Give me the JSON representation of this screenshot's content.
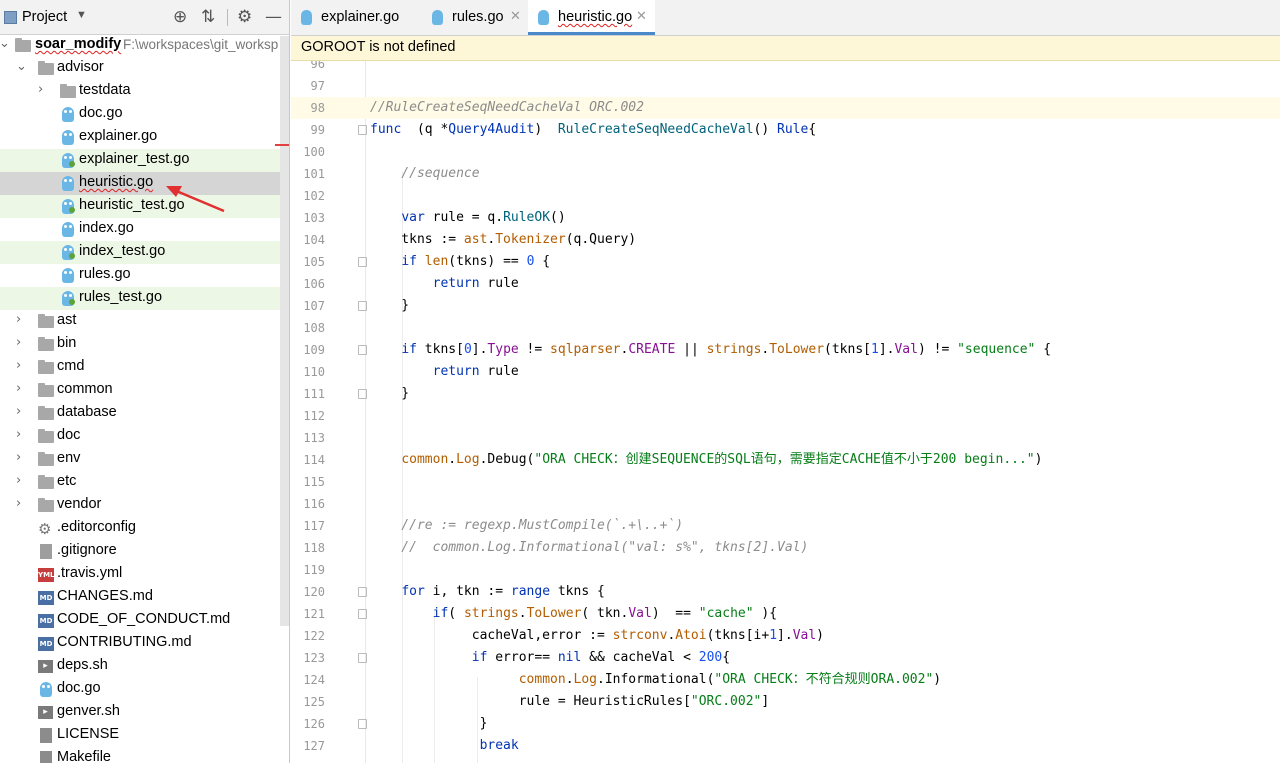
{
  "project": {
    "title": "Project",
    "root_name": "soar_modify",
    "root_path": "F:\\workspaces\\git_worksp",
    "tree": [
      {
        "label": "soar_modify",
        "depth": 0,
        "type": "root"
      },
      {
        "label": "advisor",
        "depth": 1,
        "type": "folder",
        "expanded": true
      },
      {
        "label": "testdata",
        "depth": 2,
        "type": "folder"
      },
      {
        "label": "doc.go",
        "depth": 2,
        "type": "go"
      },
      {
        "label": "explainer.go",
        "depth": 2,
        "type": "go"
      },
      {
        "label": "explainer_test.go",
        "depth": 2,
        "type": "go-test"
      },
      {
        "label": "heuristic.go",
        "depth": 2,
        "type": "go",
        "selected": true
      },
      {
        "label": "heuristic_test.go",
        "depth": 2,
        "type": "go-test"
      },
      {
        "label": "index.go",
        "depth": 2,
        "type": "go"
      },
      {
        "label": "index_test.go",
        "depth": 2,
        "type": "go-test"
      },
      {
        "label": "rules.go",
        "depth": 2,
        "type": "go"
      },
      {
        "label": "rules_test.go",
        "depth": 2,
        "type": "go-test"
      },
      {
        "label": "ast",
        "depth": 1,
        "type": "folder"
      },
      {
        "label": "bin",
        "depth": 1,
        "type": "folder"
      },
      {
        "label": "cmd",
        "depth": 1,
        "type": "folder"
      },
      {
        "label": "common",
        "depth": 1,
        "type": "folder"
      },
      {
        "label": "database",
        "depth": 1,
        "type": "folder"
      },
      {
        "label": "doc",
        "depth": 1,
        "type": "folder"
      },
      {
        "label": "env",
        "depth": 1,
        "type": "folder"
      },
      {
        "label": "etc",
        "depth": 1,
        "type": "folder"
      },
      {
        "label": "vendor",
        "depth": 1,
        "type": "folder"
      },
      {
        "label": ".editorconfig",
        "depth": 1,
        "type": "config"
      },
      {
        "label": ".gitignore",
        "depth": 1,
        "type": "gitignore"
      },
      {
        "label": ".travis.yml",
        "depth": 1,
        "type": "yml"
      },
      {
        "label": "CHANGES.md",
        "depth": 1,
        "type": "md"
      },
      {
        "label": "CODE_OF_CONDUCT.md",
        "depth": 1,
        "type": "md"
      },
      {
        "label": "CONTRIBUTING.md",
        "depth": 1,
        "type": "md"
      },
      {
        "label": "deps.sh",
        "depth": 1,
        "type": "sh"
      },
      {
        "label": "doc.go",
        "depth": 1,
        "type": "go"
      },
      {
        "label": "genver.sh",
        "depth": 1,
        "type": "sh"
      },
      {
        "label": "LICENSE",
        "depth": 1,
        "type": "license"
      },
      {
        "label": "Makefile",
        "depth": 1,
        "type": "license"
      }
    ]
  },
  "tabs": [
    {
      "label": "explainer.go",
      "active": false
    },
    {
      "label": "rules.go",
      "active": false
    },
    {
      "label": "heuristic.go",
      "active": true
    }
  ],
  "banner": "GOROOT is not defined",
  "code": {
    "lines": [
      {
        "n": "96",
        "text": ""
      },
      {
        "n": "97",
        "text": ""
      },
      {
        "n": "98",
        "text": "//RuleCreateSeqNeedCacheVal ORC.002"
      },
      {
        "n": "99",
        "text": "func  (q *Query4Audit)  RuleCreateSeqNeedCacheVal() Rule{"
      },
      {
        "n": "100",
        "text": ""
      },
      {
        "n": "101",
        "text": "    //sequence"
      },
      {
        "n": "102",
        "text": ""
      },
      {
        "n": "103",
        "text": "    var rule = q.RuleOK()"
      },
      {
        "n": "104",
        "text": "    tkns := ast.Tokenizer(q.Query)"
      },
      {
        "n": "105",
        "text": "    if len(tkns) == 0 {"
      },
      {
        "n": "106",
        "text": "        return rule"
      },
      {
        "n": "107",
        "text": "    }"
      },
      {
        "n": "108",
        "text": ""
      },
      {
        "n": "109",
        "text": "    if tkns[0].Type != sqlparser.CREATE || strings.ToLower(tkns[1].Val) != \"sequence\" {"
      },
      {
        "n": "110",
        "text": "        return rule"
      },
      {
        "n": "111",
        "text": "    }"
      },
      {
        "n": "112",
        "text": ""
      },
      {
        "n": "113",
        "text": ""
      },
      {
        "n": "114",
        "text": "    common.Log.Debug(\"ORA CHECK：创建SEQUENCE的SQL语句，需要指定CACHE值不小于200 begin...\")"
      },
      {
        "n": "115",
        "text": ""
      },
      {
        "n": "116",
        "text": ""
      },
      {
        "n": "117",
        "text": "    //re := regexp.MustCompile(`.+\\..+`)"
      },
      {
        "n": "118",
        "text": "    //  common.Log.Informational(\"val: s%\", tkns[2].Val)"
      },
      {
        "n": "119",
        "text": ""
      },
      {
        "n": "120",
        "text": "    for i, tkn := range tkns {"
      },
      {
        "n": "121",
        "text": "        if( strings.ToLower( tkn.Val)  == \"cache\" ){"
      },
      {
        "n": "122",
        "text": "             cacheVal,error := strconv.Atoi(tkns[i+1].Val)"
      },
      {
        "n": "123",
        "text": "             if error== nil && cacheVal < 200{"
      },
      {
        "n": "124",
        "text": "                   common.Log.Informational(\"ORA CHECK：不符合规则ORA.002\")"
      },
      {
        "n": "125",
        "text": "                   rule = HeuristicRules[\"ORC.002\"]"
      },
      {
        "n": "126",
        "text": "              }"
      },
      {
        "n": "127",
        "text": "              break"
      }
    ]
  },
  "colors": {
    "keyword": "#0033b3",
    "string": "#067d17",
    "comment": "#8c8c8c",
    "selection": "#d5d5d5",
    "test_file_bg": "#edf7e6",
    "banner_bg": "#fdf6d7",
    "annotation_arrow": "#e03030"
  }
}
